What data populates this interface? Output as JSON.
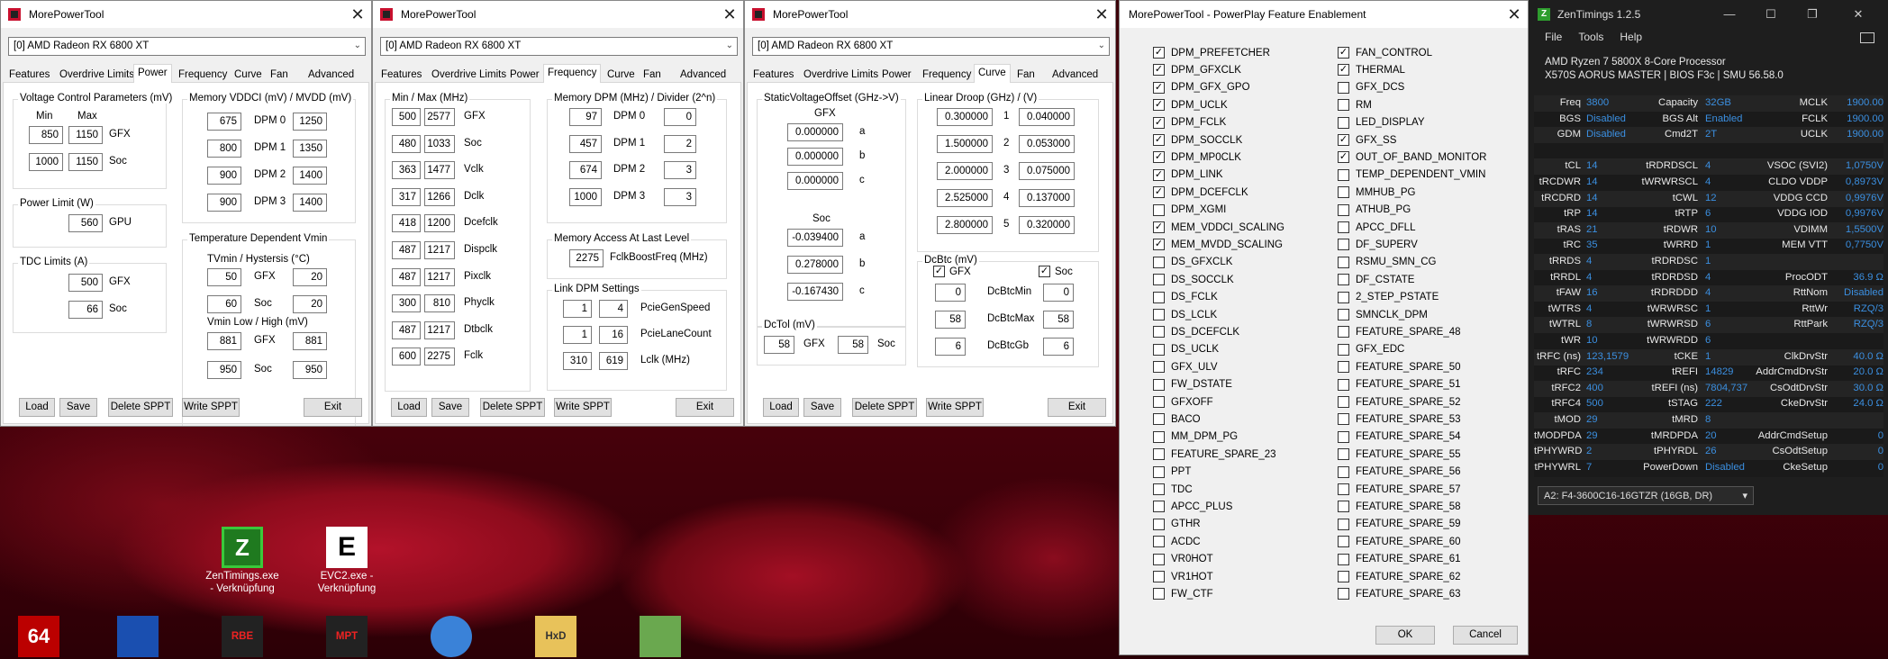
{
  "desktop": {
    "icons": [
      {
        "label": "ZenTimings.exe - Verknüpfung"
      },
      {
        "label": "EVC2.exe - Verknüpfung"
      }
    ]
  },
  "mpt": {
    "title": "MorePowerTool",
    "gpu": "[0] AMD Radeon RX 6800 XT",
    "tabs": [
      "Features",
      "Overdrive Limits",
      "Power",
      "Frequency",
      "Curve",
      "Fan",
      "Advanced"
    ],
    "buttons": {
      "load": "Load",
      "save": "Save",
      "delete": "Delete SPPT",
      "write": "Write SPPT",
      "exit": "Exit"
    },
    "power": {
      "vc_caption": "Voltage Control Parameters (mV)",
      "min": "Min",
      "max": "Max",
      "gfx": "GFX",
      "soc": "Soc",
      "vc_gfx_min": "850",
      "vc_gfx_max": "1150",
      "vc_soc_min": "1000",
      "vc_soc_max": "1150",
      "pl_caption": "Power Limit (W)",
      "pl_val": "560",
      "gpu": "GPU",
      "tdc_caption": "TDC Limits (A)",
      "tdc_gfx": "500",
      "tdc_soc": "66",
      "mem_caption": "Memory VDDCI (mV) / MVDD (mV)",
      "dpm": [
        {
          "l": "DPM 0",
          "a": "675",
          "b": "1250"
        },
        {
          "l": "DPM 1",
          "a": "800",
          "b": "1350"
        },
        {
          "l": "DPM 2",
          "a": "900",
          "b": "1400"
        },
        {
          "l": "DPM 3",
          "a": "900",
          "b": "1400"
        }
      ],
      "temp_caption": "Temperature Dependent Vmin",
      "tvmin": "TVmin / Hystersis (°C)",
      "tv_gfx_a": "50",
      "tv_gfx_b": "20",
      "tv_soc_a": "60",
      "tv_soc_b": "20",
      "vmin_caption": "Vmin Low / High (mV)",
      "vm_gfx_a": "881",
      "vm_gfx_b": "881",
      "vm_soc_a": "950",
      "vm_soc_b": "950"
    },
    "freq": {
      "mm_caption": "Min / Max (MHz)",
      "rows": [
        {
          "a": "500",
          "b": "2577",
          "l": "GFX"
        },
        {
          "a": "480",
          "b": "1033",
          "l": "Soc"
        },
        {
          "a": "363",
          "b": "1477",
          "l": "Vclk"
        },
        {
          "a": "317",
          "b": "1266",
          "l": "Dclk"
        },
        {
          "a": "418",
          "b": "1200",
          "l": "Dcefclk"
        },
        {
          "a": "487",
          "b": "1217",
          "l": "Dispclk"
        },
        {
          "a": "487",
          "b": "1217",
          "l": "Pixclk"
        },
        {
          "a": "300",
          "b": "810",
          "l": "Phyclk"
        },
        {
          "a": "487",
          "b": "1217",
          "l": "Dtbclk"
        },
        {
          "a": "600",
          "b": "2275",
          "l": "Fclk"
        }
      ],
      "memdpm_caption": "Memory DPM (MHz) / Divider (2^n)",
      "memdpm": [
        {
          "a": "97",
          "l": "DPM 0",
          "b": "0"
        },
        {
          "a": "457",
          "l": "DPM 1",
          "b": "2"
        },
        {
          "a": "674",
          "l": "DPM 2",
          "b": "3"
        },
        {
          "a": "1000",
          "l": "DPM 3",
          "b": "3"
        }
      ],
      "mal_caption": "Memory Access At Last Level",
      "mal_val": "2275",
      "mal_label": "FclkBoostFreq (MHz)",
      "link_caption": "Link DPM Settings",
      "pcie_gen_a": "1",
      "pcie_gen_b": "4",
      "pcie_gen_l": "PcieGenSpeed",
      "pcie_lane_a": "1",
      "pcie_lane_b": "16",
      "pcie_lane_l": "PcieLaneCount",
      "lclk_a": "310",
      "lclk_b": "619",
      "lclk_l": "Lclk (MHz)"
    },
    "curve": {
      "svo_caption": "StaticVoltageOffset (GHz->V)",
      "gfx": "GFX",
      "soc": "Soc",
      "gfx_vals": [
        {
          "v": "0.000000",
          "l": "a"
        },
        {
          "v": "0.000000",
          "l": "b"
        },
        {
          "v": "0.000000",
          "l": "c"
        }
      ],
      "soc_vals": [
        {
          "v": "-0.039400",
          "l": "a"
        },
        {
          "v": "0.278000",
          "l": "b"
        },
        {
          "v": "-0.167430",
          "l": "c"
        }
      ],
      "ld_caption": "Linear Droop (GHz) / (V)",
      "ld": [
        {
          "a": "0.300000",
          "n": "1",
          "b": "0.040000"
        },
        {
          "a": "1.500000",
          "n": "2",
          "b": "0.053000"
        },
        {
          "a": "2.000000",
          "n": "3",
          "b": "0.075000"
        },
        {
          "a": "2.525000",
          "n": "4",
          "b": "0.137000"
        },
        {
          "a": "2.800000",
          "n": "5",
          "b": "0.320000"
        }
      ],
      "dcbtc_caption": "DcBtc (mV)",
      "chk_gfx": "GFX",
      "chk_soc": "Soc",
      "dcb": [
        {
          "a": "0",
          "l": "DcBtcMin",
          "b": "0"
        },
        {
          "a": "58",
          "l": "DcBtcMax",
          "b": "58"
        },
        {
          "a": "6",
          "l": "DcBtcGb",
          "b": "6"
        }
      ],
      "dctol_caption": "DcTol (mV)",
      "dctol_gfx": "58",
      "dctol_gfx_l": "GFX",
      "dctol_soc": "58",
      "dctol_soc_l": "Soc"
    }
  },
  "ppfe": {
    "title": "MorePowerTool - PowerPlay Feature Enablement",
    "ok": "OK",
    "cancel": "Cancel",
    "left": [
      {
        "n": "DPM_PREFETCHER",
        "c": true
      },
      {
        "n": "DPM_GFXCLK",
        "c": true
      },
      {
        "n": "DPM_GFX_GPO",
        "c": true
      },
      {
        "n": "DPM_UCLK",
        "c": true
      },
      {
        "n": "DPM_FCLK",
        "c": true
      },
      {
        "n": "DPM_SOCCLK",
        "c": true
      },
      {
        "n": "DPM_MP0CLK",
        "c": true
      },
      {
        "n": "DPM_LINK",
        "c": true
      },
      {
        "n": "DPM_DCEFCLK",
        "c": true
      },
      {
        "n": "DPM_XGMI",
        "c": false
      },
      {
        "n": "MEM_VDDCI_SCALING",
        "c": true
      },
      {
        "n": "MEM_MVDD_SCALING",
        "c": true
      },
      {
        "n": "DS_GFXCLK",
        "c": false
      },
      {
        "n": "DS_SOCCLK",
        "c": false
      },
      {
        "n": "DS_FCLK",
        "c": false
      },
      {
        "n": "DS_LCLK",
        "c": false
      },
      {
        "n": "DS_DCEFCLK",
        "c": false
      },
      {
        "n": "DS_UCLK",
        "c": false
      },
      {
        "n": "GFX_ULV",
        "c": false
      },
      {
        "n": "FW_DSTATE",
        "c": false
      },
      {
        "n": "GFXOFF",
        "c": false
      },
      {
        "n": "BACO",
        "c": false
      },
      {
        "n": "MM_DPM_PG",
        "c": false
      },
      {
        "n": "FEATURE_SPARE_23",
        "c": false
      },
      {
        "n": "PPT",
        "c": false
      },
      {
        "n": "TDC",
        "c": false
      },
      {
        "n": "APCC_PLUS",
        "c": false
      },
      {
        "n": "GTHR",
        "c": false
      },
      {
        "n": "ACDC",
        "c": false
      },
      {
        "n": "VR0HOT",
        "c": false
      },
      {
        "n": "VR1HOT",
        "c": false
      },
      {
        "n": "FW_CTF",
        "c": false
      }
    ],
    "right": [
      {
        "n": "FAN_CONTROL",
        "c": true
      },
      {
        "n": "THERMAL",
        "c": true
      },
      {
        "n": "GFX_DCS",
        "c": false
      },
      {
        "n": "RM",
        "c": false
      },
      {
        "n": "LED_DISPLAY",
        "c": false
      },
      {
        "n": "GFX_SS",
        "c": true
      },
      {
        "n": "OUT_OF_BAND_MONITOR",
        "c": true
      },
      {
        "n": "TEMP_DEPENDENT_VMIN",
        "c": false
      },
      {
        "n": "MMHUB_PG",
        "c": false
      },
      {
        "n": "ATHUB_PG",
        "c": false
      },
      {
        "n": "APCC_DFLL",
        "c": false
      },
      {
        "n": "DF_SUPERV",
        "c": false
      },
      {
        "n": "RSMU_SMN_CG",
        "c": false
      },
      {
        "n": "DF_CSTATE",
        "c": false
      },
      {
        "n": "2_STEP_PSTATE",
        "c": false
      },
      {
        "n": "SMNCLK_DPM",
        "c": false
      },
      {
        "n": "FEATURE_SPARE_48",
        "c": false
      },
      {
        "n": "GFX_EDC",
        "c": false
      },
      {
        "n": "FEATURE_SPARE_50",
        "c": false
      },
      {
        "n": "FEATURE_SPARE_51",
        "c": false
      },
      {
        "n": "FEATURE_SPARE_52",
        "c": false
      },
      {
        "n": "FEATURE_SPARE_53",
        "c": false
      },
      {
        "n": "FEATURE_SPARE_54",
        "c": false
      },
      {
        "n": "FEATURE_SPARE_55",
        "c": false
      },
      {
        "n": "FEATURE_SPARE_56",
        "c": false
      },
      {
        "n": "FEATURE_SPARE_57",
        "c": false
      },
      {
        "n": "FEATURE_SPARE_58",
        "c": false
      },
      {
        "n": "FEATURE_SPARE_59",
        "c": false
      },
      {
        "n": "FEATURE_SPARE_60",
        "c": false
      },
      {
        "n": "FEATURE_SPARE_61",
        "c": false
      },
      {
        "n": "FEATURE_SPARE_62",
        "c": false
      },
      {
        "n": "FEATURE_SPARE_63",
        "c": false
      }
    ]
  },
  "zt": {
    "title": "ZenTimings 1.2.5",
    "menu": [
      "File",
      "Tools",
      "Help"
    ],
    "cpu": "AMD Ryzen 7 5800X 8-Core Processor",
    "board": "X570S AORUS MASTER | BIOS F3c | SMU 56.58.0",
    "rows": [
      [
        "Freq",
        "3800",
        "Capacity",
        "32GB",
        "MCLK",
        "1900.00"
      ],
      [
        "BGS",
        "Disabled",
        "BGS Alt",
        "Enabled",
        "FCLK",
        "1900.00"
      ],
      [
        "GDM",
        "Disabled",
        "Cmd2T",
        "2T",
        "UCLK",
        "1900.00"
      ],
      [
        "",
        "",
        "",
        "",
        "",
        ""
      ],
      [
        "tCL",
        "14",
        "tRDRDSCL",
        "4",
        "VSOC (SVI2)",
        "1,0750V"
      ],
      [
        "tRCDWR",
        "14",
        "tWRWRSCL",
        "4",
        "CLDO VDDP",
        "0,8973V"
      ],
      [
        "tRCDRD",
        "14",
        "tCWL",
        "12",
        "VDDG CCD",
        "0,9976V"
      ],
      [
        "tRP",
        "14",
        "tRTP",
        "6",
        "VDDG IOD",
        "0,9976V"
      ],
      [
        "tRAS",
        "21",
        "tRDWR",
        "10",
        "VDIMM",
        "1,5500V"
      ],
      [
        "tRC",
        "35",
        "tWRRD",
        "1",
        "MEM VTT",
        "0,7750V"
      ],
      [
        "tRRDS",
        "4",
        "tRDRDSC",
        "1",
        "",
        ""
      ],
      [
        "tRRDL",
        "4",
        "tRDRDSD",
        "4",
        "ProcODT",
        "36.9 Ω"
      ],
      [
        "tFAW",
        "16",
        "tRDRDDD",
        "4",
        "RttNom",
        "Disabled"
      ],
      [
        "tWTRS",
        "4",
        "tWRWRSC",
        "1",
        "RttWr",
        "RZQ/3"
      ],
      [
        "tWTRL",
        "8",
        "tWRWRSD",
        "6",
        "RttPark",
        "RZQ/3"
      ],
      [
        "tWR",
        "10",
        "tWRWRDD",
        "6",
        "",
        ""
      ],
      [
        "tRFC (ns)",
        "123,1579",
        "tCKE",
        "1",
        "ClkDrvStr",
        "40.0 Ω"
      ],
      [
        "tRFC",
        "234",
        "tREFI",
        "14829",
        "AddrCmdDrvStr",
        "20.0 Ω"
      ],
      [
        "tRFC2",
        "400",
        "tREFI (ns)",
        "7804,737",
        "CsOdtDrvStr",
        "30.0 Ω"
      ],
      [
        "tRFC4",
        "500",
        "tSTAG",
        "222",
        "CkeDrvStr",
        "24.0 Ω"
      ],
      [
        "tMOD",
        "29",
        "tMRD",
        "8",
        "",
        ""
      ],
      [
        "tMODPDA",
        "29",
        "tMRDPDA",
        "20",
        "AddrCmdSetup",
        "0"
      ],
      [
        "tPHYWRD",
        "2",
        "tPHYRDL",
        "26",
        "CsOdtSetup",
        "0"
      ],
      [
        "tPHYWRL",
        "7",
        "PowerDown",
        "Disabled",
        "CkeSetup",
        "0"
      ]
    ],
    "module": "A2: F4-3600C16-16GTZR (16GB, DR)"
  }
}
